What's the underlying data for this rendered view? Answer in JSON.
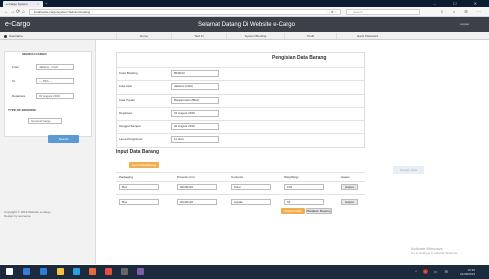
{
  "browser": {
    "tab_title": "e-Cargo System",
    "tab_close": "×",
    "new_tab": "+",
    "window_controls": "– ☐ ✕",
    "url": "localhost/e-cargo/system/?admin=booking",
    "page_icons": "⋯ ✿ ☆",
    "search_placeholder": "Search",
    "toolbar_icons": "⇩ ⌂ ☰ ⋯"
  },
  "site": {
    "brand": "e-Cargo",
    "welcome": "Selamat Datang Di Website e-Cargo",
    "logout": "Logout",
    "user": "Username"
  },
  "menu": [
    "Home",
    "Tarif Ki",
    "System Booking",
    "Profil",
    "Ganti Password"
  ],
  "sidebar": {
    "search_title": "SEARCH CARGO",
    "from_label": "From",
    "from_value": "Jakarta - CGK",
    "to_label": "To",
    "to_value": "--- Pilih ---",
    "departure_label": "Departure",
    "departure_value": "01 August 2019",
    "type_title": "TYPE OF BOOKING",
    "type_value": "General Cargo",
    "search_button": "Search",
    "copyright_line1": "Copyright © 2019 Website e-Cargo",
    "copyright_line2": "Design by someone"
  },
  "form": {
    "title": "Pengisian Data Barang",
    "rows": [
      {
        "label": "Kode Booking",
        "value": "BK0013"
      },
      {
        "label": "Kota Asal",
        "value": "Jakarta (CGK)"
      },
      {
        "label": "Kota Tujuan",
        "value": "Banjarmasin (BDJ)"
      },
      {
        "label": "Departure",
        "value": "01 August 2019"
      },
      {
        "label": "Tanggal Sampai",
        "value": "02 August 2019"
      },
      {
        "label": "Lama Pengiriman",
        "value": "1x Hari"
      }
    ]
  },
  "items": {
    "title": "Input Data Barang",
    "add_button": "Input Data Barang",
    "headers": [
      "Packaging",
      "Dimensi (cm)",
      "Contents",
      "Weight(kg)",
      "Hapus"
    ],
    "rows": [
      {
        "packaging": "Box",
        "dimensi": "30x30x30",
        "contents": "buku",
        "weight": "105",
        "hapus": "Hapus"
      },
      {
        "packaging": "Box",
        "dimensi": "20x20x20",
        "contents": "sepatu",
        "weight": "64",
        "hapus": "Hapus"
      }
    ],
    "simpan_button": "Simpan Data",
    "batal_button": "Batalkan Booking"
  },
  "ghost_button": "Simpan Data",
  "watermark": {
    "line1": "Activate Windows",
    "line2": "Go to Settings to activate Windows."
  },
  "taskbar": {
    "tray_icons": "^ ◐ ▭ ✉",
    "time": "16:35",
    "date": "01/08/2019",
    "icon_colors": [
      "#ffffff",
      "#3a7bd5",
      "#2b7cd3",
      "#f6c143",
      "#2aa1dc",
      "#e8693e",
      "#e74c3c",
      "#666666",
      "#7b5ea7"
    ],
    "tray_notify_color": "#c0392b"
  },
  "colors": {
    "header_bg": "#3d4048",
    "accent_orange": "#f0ad4e",
    "search_blue": "#5b9bd5"
  }
}
